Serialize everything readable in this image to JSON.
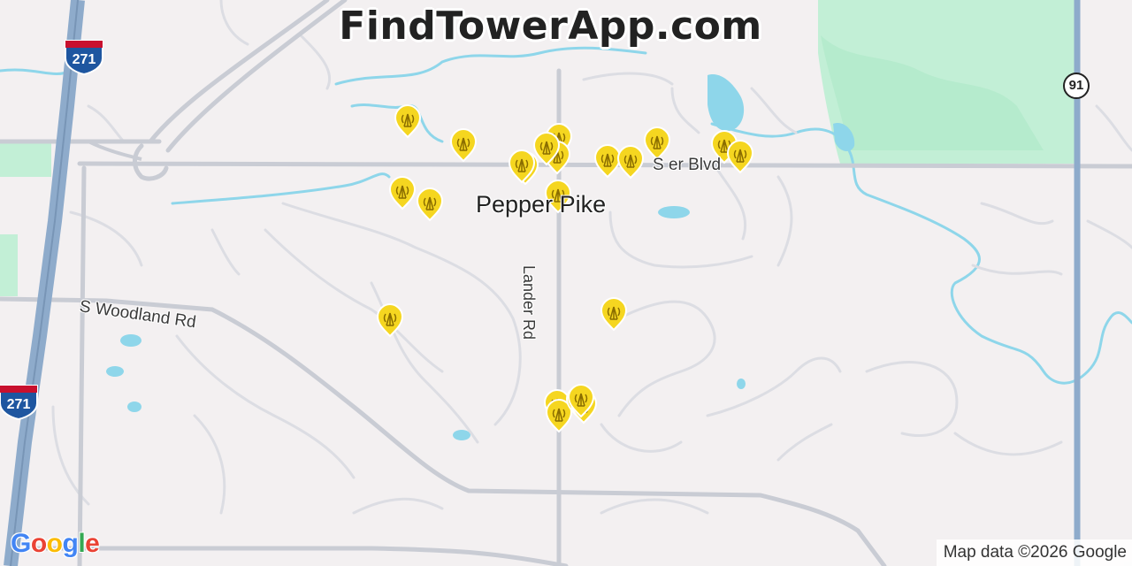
{
  "header": {
    "title": "FindTowerApp.com"
  },
  "map": {
    "place_label": "Pepper Pike",
    "roads": {
      "woodland": "S Woodland Rd",
      "lander": "Lander Rd",
      "blvd": "S   er Blvd"
    },
    "highway_shields": {
      "interstate_top": "271",
      "interstate_bottom": "271",
      "state_route": "91"
    },
    "colors": {
      "background": "#f3f0f1",
      "water": "#8ed6ea",
      "park": "#bfefd5",
      "highway": "#8eabcb",
      "pin": "#f5d620"
    },
    "tower_pin_icon": "cell-tower-pin-icon",
    "tower_pin_count": 23
  },
  "footer": {
    "logo": {
      "g": "G",
      "o1": "o",
      "o2": "o",
      "g2": "g",
      "l": "l",
      "e": "e"
    },
    "attribution": "Map data ©2026 Google"
  }
}
